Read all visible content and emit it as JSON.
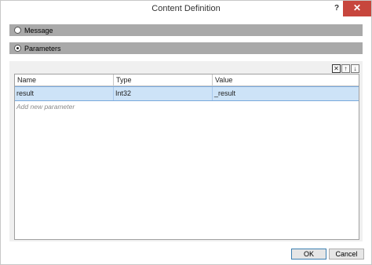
{
  "window": {
    "title": "Content Definition",
    "help_glyph": "?",
    "close_glyph": "✕"
  },
  "sections": {
    "message_label": "Message",
    "parameters_label": "Parameters",
    "selected": "parameters"
  },
  "toolbar": {
    "delete_glyph": "✕",
    "up_glyph": "↑",
    "down_glyph": "↓"
  },
  "grid": {
    "columns": [
      "Name",
      "Type",
      "Value"
    ],
    "rows": [
      {
        "name": "result",
        "type": "Int32",
        "value": "_result"
      }
    ],
    "add_placeholder": "Add new parameter"
  },
  "buttons": {
    "ok": "OK",
    "cancel": "Cancel"
  },
  "colors": {
    "section_bar": "#a9a9a9",
    "selected_row": "#cde3f7",
    "close_button": "#c7463d"
  }
}
